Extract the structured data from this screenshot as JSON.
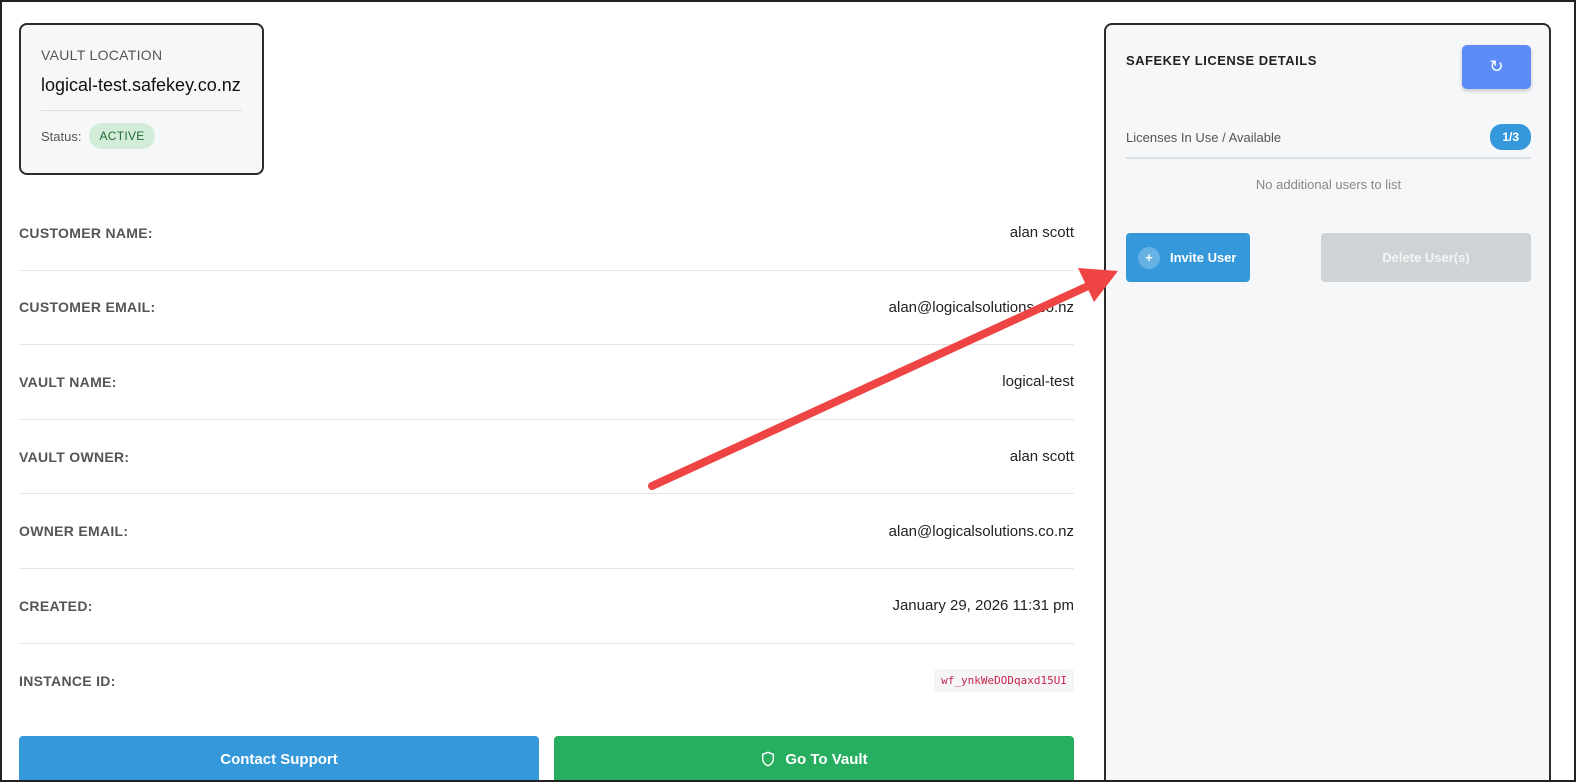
{
  "vault": {
    "location_label": "VAULT LOCATION",
    "location_value": "logical-test.safekey.co.nz",
    "status_label": "Status:",
    "status_value": "ACTIVE"
  },
  "details": [
    {
      "label": "CUSTOMER NAME:",
      "value": "alan scott"
    },
    {
      "label": "CUSTOMER EMAIL:",
      "value": "alan@logicalsolutions.co.nz"
    },
    {
      "label": "VAULT NAME:",
      "value": "logical-test"
    },
    {
      "label": "VAULT OWNER:",
      "value": "alan scott"
    },
    {
      "label": "OWNER EMAIL:",
      "value": "alan@logicalsolutions.co.nz"
    },
    {
      "label": "CREATED:",
      "value": "January 29, 2026 11:31 pm"
    },
    {
      "label": "INSTANCE ID:",
      "value": "wf_ynkWeDODqaxd15UI"
    }
  ],
  "buttons": {
    "contact_support": "Contact Support",
    "go_to_vault": "Go To Vault"
  },
  "license_panel": {
    "title": "SAFEKEY LICENSE DETAILS",
    "refresh_icon": "↻",
    "licenses_label": "Licenses In Use / Available",
    "licenses_value": "1/3",
    "empty_message": "No additional users to list",
    "invite_label": "Invite User",
    "delete_label": "Delete User(s)"
  },
  "colors": {
    "primary": "#3498db",
    "success": "#27ae60",
    "refresh": "#5b8cf7",
    "status_bg": "#d4edda",
    "annotation_arrow": "#ee4444"
  }
}
